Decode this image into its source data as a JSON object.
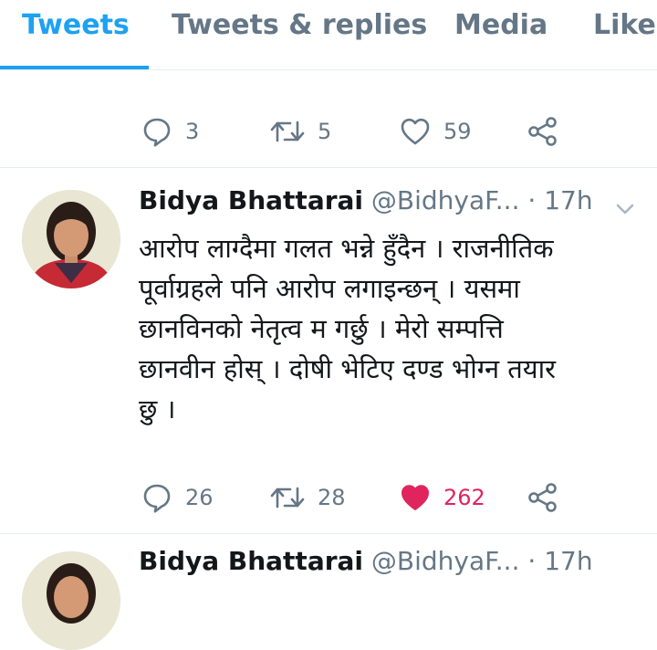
{
  "tabs": [
    {
      "label": "Tweets",
      "active": true
    },
    {
      "label": "Tweets & replies",
      "active": false
    },
    {
      "label": "Media",
      "active": false
    },
    {
      "label": "Likes",
      "active": false
    }
  ],
  "prev_tweet": {
    "replies": "3",
    "retweets": "5",
    "likes": "59"
  },
  "tweet": {
    "author": "Bidya Bhattarai",
    "handle": "@BidhyaF...",
    "separator": "·",
    "time": "17h",
    "text_lines": [
      "आरोप लाग्दैमा गलत भन्ने हुँदैन । राजनीतिक",
      "पूर्वाग्रहले पनि आरोप लगाइन्छन् । यसमा",
      "छानविनको नेतृत्व म गर्छु । मेरो सम्पत्ति",
      "छानवीन होस् । दोषी भेटिए दण्ड भोग्न तयार",
      "छु ।"
    ],
    "replies": "26",
    "retweets": "28",
    "likes": "262",
    "liked": true
  },
  "next_tweet": {
    "author": "Bidya Bhattarai",
    "handle": "@BidhyaF...",
    "separator": "·",
    "time": "17h"
  },
  "colors": {
    "accent": "#1da1f2",
    "secondary_text": "#657786",
    "like": "#e0245e",
    "divider": "#e6ecf0"
  },
  "icons": [
    "reply-icon",
    "retweet-icon",
    "heart-icon",
    "share-icon",
    "chevron-down-icon"
  ]
}
